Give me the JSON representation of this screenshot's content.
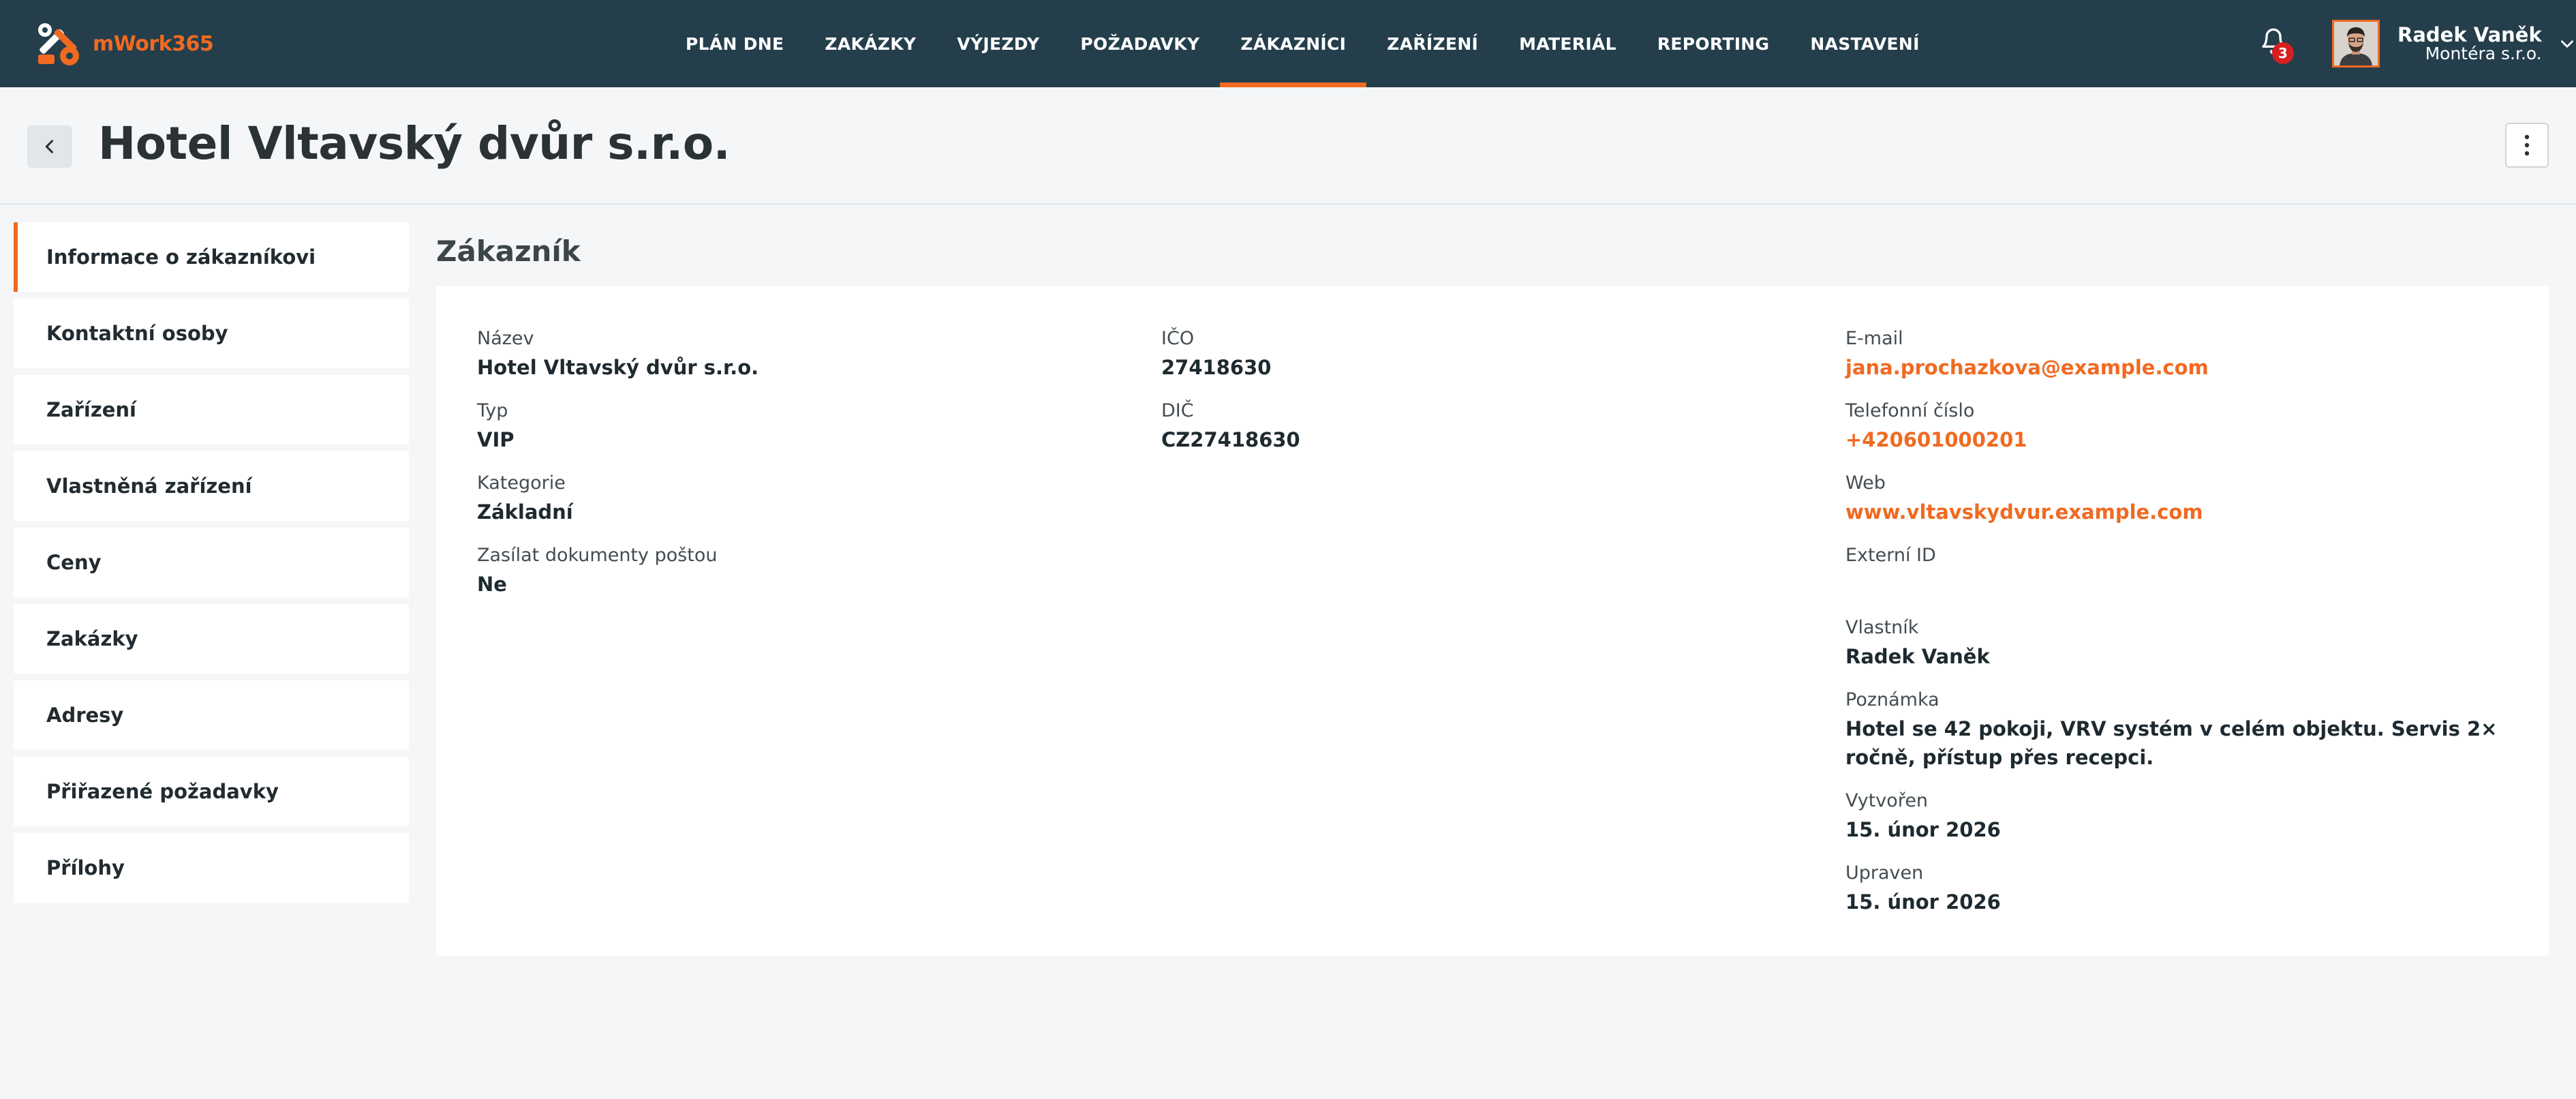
{
  "app": {
    "brand": "mWork365",
    "brand_color": "#f06a21",
    "nav_bg": "#243e4c"
  },
  "nav": {
    "items": [
      {
        "label": "PLÁN DNE",
        "active": false
      },
      {
        "label": "ZAKÁZKY",
        "active": false
      },
      {
        "label": "VÝJEZDY",
        "active": false
      },
      {
        "label": "POŽADAVKY",
        "active": false
      },
      {
        "label": "ZÁKAZNÍCI",
        "active": true
      },
      {
        "label": "ZAŘÍZENÍ",
        "active": false
      },
      {
        "label": "MATERIÁL",
        "active": false
      },
      {
        "label": "REPORTING",
        "active": false
      },
      {
        "label": "NASTAVENÍ",
        "active": false
      }
    ]
  },
  "notifications": {
    "icon": "bell-icon",
    "count": "3"
  },
  "user": {
    "name": "Radek Vaněk",
    "company": "Montéra s.r.o.",
    "menu_icon": "chevron-down-icon"
  },
  "header": {
    "title": "Hotel Vltavský dvůr s.r.o.",
    "back_icon": "chevron-left-icon",
    "more_icon": "more-vertical-icon"
  },
  "sidebar": {
    "items": [
      {
        "label": "Informace o zákazníkovi",
        "active": true
      },
      {
        "label": "Kontaktní osoby",
        "active": false
      },
      {
        "label": "Zařízení",
        "active": false
      },
      {
        "label": "Vlastněná zařízení",
        "active": false
      },
      {
        "label": "Ceny",
        "active": false
      },
      {
        "label": "Zakázky",
        "active": false
      },
      {
        "label": "Adresy",
        "active": false
      },
      {
        "label": "Přiřazené požadavky",
        "active": false
      },
      {
        "label": "Přílohy",
        "active": false
      }
    ]
  },
  "customer": {
    "section_title": "Zákazník",
    "col1": [
      {
        "label": "Název",
        "value": "Hotel Vltavský dvůr s.r.o."
      },
      {
        "label": "Typ",
        "value": "VIP"
      },
      {
        "label": "Kategorie",
        "value": "Základní"
      },
      {
        "label": "Zasílat dokumenty poštou",
        "value": "Ne"
      }
    ],
    "col2": [
      {
        "label": "IČO",
        "value": "27418630"
      },
      {
        "label": "DIČ",
        "value": "CZ27418630"
      }
    ],
    "col3": [
      {
        "label": "E-mail",
        "value": "jana.prochazkova@example.com",
        "link": true
      },
      {
        "label": "Telefonní číslo",
        "value": "+420601000201",
        "link": true
      },
      {
        "label": "Web",
        "value": "www.vltavskydvur.example.com",
        "link": true
      },
      {
        "label": "Externí ID",
        "value": ""
      },
      {
        "label": "Vlastník",
        "value": "Radek Vaněk"
      },
      {
        "label": "Poznámka",
        "value": "Hotel se 42 pokoji, VRV systém v celém objektu. Servis 2× ročně, přístup přes recepci."
      },
      {
        "label": "Vytvořen",
        "value": "15. únor 2026"
      },
      {
        "label": "Upraven",
        "value": "15. únor 2026"
      }
    ]
  }
}
